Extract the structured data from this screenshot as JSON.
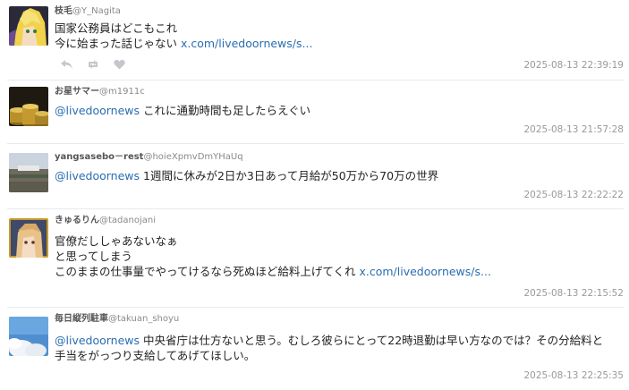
{
  "tweets": [
    {
      "name": "枝毛",
      "handle": "@Y_Nagita",
      "lines": [
        {
          "text": "国家公務員はどこもこれ"
        },
        {
          "text": "今に始まった話じゃない ",
          "link": "x.com/livedoornews/s..."
        }
      ],
      "timestamp": "2025-08-13 22:39:19"
    },
    {
      "name": "お星サマー",
      "handle": "@m1911c",
      "lines": [
        {
          "mention": "@livedoornews",
          "text": " これに通勤時間も足したらえぐい"
        }
      ],
      "timestamp": "2025-08-13 21:57:28"
    },
    {
      "name": "yangsasebo－rest",
      "handle": "@hoieXpmvDmYHaUq",
      "lines": [
        {
          "mention": "@livedoornews",
          "text": " 1週間に休みが2日か3日あって月給が50万から70万の世界"
        }
      ],
      "timestamp": "2025-08-13 22:22:22"
    },
    {
      "name": "きゅるりん",
      "handle": "@tadanojani",
      "lines": [
        {
          "text": "官僚だししゃあないなぁ"
        },
        {
          "text": "と思ってしまう"
        },
        {
          "text": "このままの仕事量でやってけるなら死ぬほど給料上げてくれ ",
          "link": "x.com/livedoornews/s..."
        }
      ],
      "timestamp": "2025-08-13 22:15:52"
    },
    {
      "name": "毎日縦列駐車",
      "handle": "@takuan_shoyu",
      "lines": [
        {
          "mention": "@livedoornews",
          "text": " 中央省庁は仕方ないと思う。むしろ彼らにとって22時退勤は早い方なのでは？その分給料と"
        },
        {
          "text": "手当をがっつり支給してあげてほしい。"
        }
      ],
      "timestamp": "2025-08-13 22:25:35"
    }
  ],
  "icons": {
    "reply": "reply-icon",
    "retweet": "retweet-icon",
    "like": "heart-icon"
  },
  "colors": {
    "link": "#2a6db0",
    "timestamp": "#999999",
    "action_icon": "#c4c8cc",
    "divider": "#e6ebef"
  }
}
